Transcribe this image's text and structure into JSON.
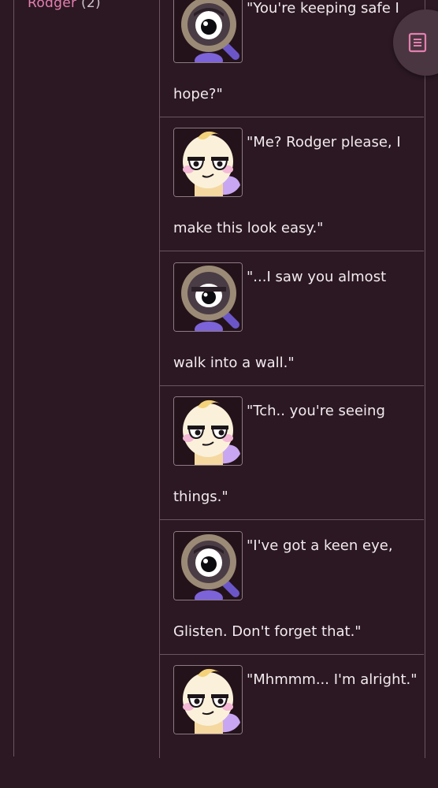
{
  "sidebar": {
    "link_label": "Rodger",
    "link_count": "(2)"
  },
  "messages": [
    {
      "speaker_icon": "magnifier-character-icon",
      "line1": "\"You're keeping safe I",
      "line2": "hope?\""
    },
    {
      "speaker_icon": "cream-character-icon",
      "line1": "\"Me? Rodger please, I",
      "line2": "make this look easy.\""
    },
    {
      "speaker_icon": "magnifier-character-icon",
      "line1": "\"...I saw you almost",
      "line2": "walk into a wall.\""
    },
    {
      "speaker_icon": "cream-character-icon",
      "line1": "\"Tch.. you're seeing",
      "line2": "things.\""
    },
    {
      "speaker_icon": "magnifier-character-icon",
      "line1": "\"I've got a keen eye,",
      "line2": "Glisten. Don't forget that.\""
    },
    {
      "speaker_icon": "cream-character-icon",
      "line1": "\"Mhmmm... I'm alright.\"",
      "line2": ""
    }
  ],
  "colors": {
    "background": "#2b1822",
    "border": "#6a5560",
    "link": "#e47fb0",
    "text": "#f2eaee",
    "toc_button": "#4a3640"
  },
  "toc_button": {
    "icon": "table-of-contents-icon"
  }
}
